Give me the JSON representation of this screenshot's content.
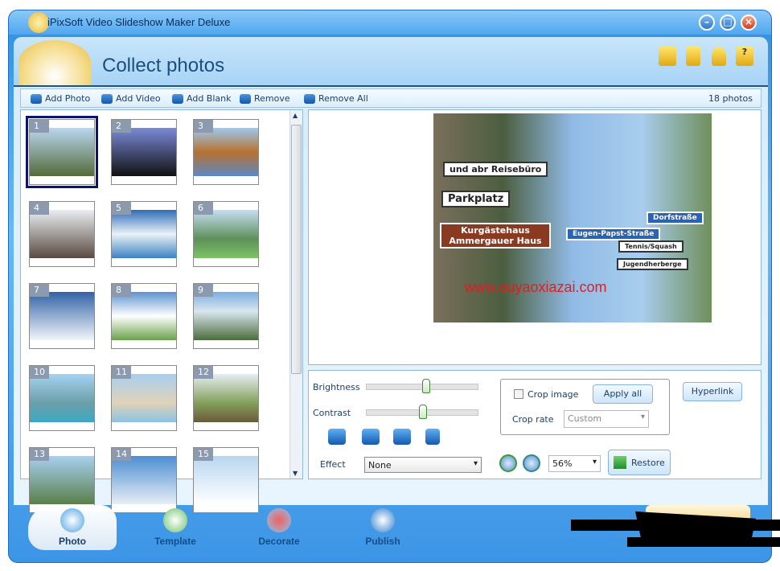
{
  "window": {
    "title": "iPixSoft Video Slideshow Maker Deluxe",
    "controls": [
      "minimize",
      "maximize",
      "close"
    ]
  },
  "header": {
    "title": "Collect photos",
    "icons": [
      "folder-icon",
      "save-icon",
      "user-icon",
      "help-icon"
    ]
  },
  "toolbar": {
    "items": [
      {
        "label": "Add Photo",
        "icon": "add-photo-icon"
      },
      {
        "label": "Add Video",
        "icon": "add-video-icon"
      },
      {
        "label": "Add Blank",
        "icon": "add-blank-icon"
      },
      {
        "label": "Remove",
        "icon": "remove-icon"
      },
      {
        "label": "Remove All",
        "icon": "remove-all-icon"
      }
    ],
    "count": "18 photos"
  },
  "thumbnails": [
    "1",
    "2",
    "3",
    "4",
    "5",
    "6",
    "7",
    "8",
    "9",
    "10",
    "11",
    "12",
    "13",
    "14",
    "15"
  ],
  "selected_thumbnail": "1",
  "preview": {
    "signs": [
      "und abr Reisebüro",
      "Parkplatz",
      "Kurgästehaus Ammergauer Haus",
      "Eugen-Papst-Straße",
      "Dorfstraße",
      "Tennis/Squash",
      "Jugendherberge"
    ],
    "watermark": "www.ouyaoxiazai.com"
  },
  "controls": {
    "brightness_label": "Brightness",
    "brightness_value": 0.53,
    "contrast_label": "Contrast",
    "contrast_value": 0.5,
    "effect_label": "Effect",
    "effect_value": "None",
    "crop_image_label": "Crop image",
    "crop_image_checked": false,
    "apply_all": "Apply all",
    "crop_rate_label": "Crop rate",
    "crop_rate_value": "Custom",
    "hyperlink": "Hyperlink",
    "zoom_value": "56%",
    "restore": "Restore"
  },
  "nav": {
    "items": [
      {
        "label": "Photo",
        "active": true
      },
      {
        "label": "Template"
      },
      {
        "label": "Decorate"
      },
      {
        "label": "Publish"
      }
    ]
  }
}
